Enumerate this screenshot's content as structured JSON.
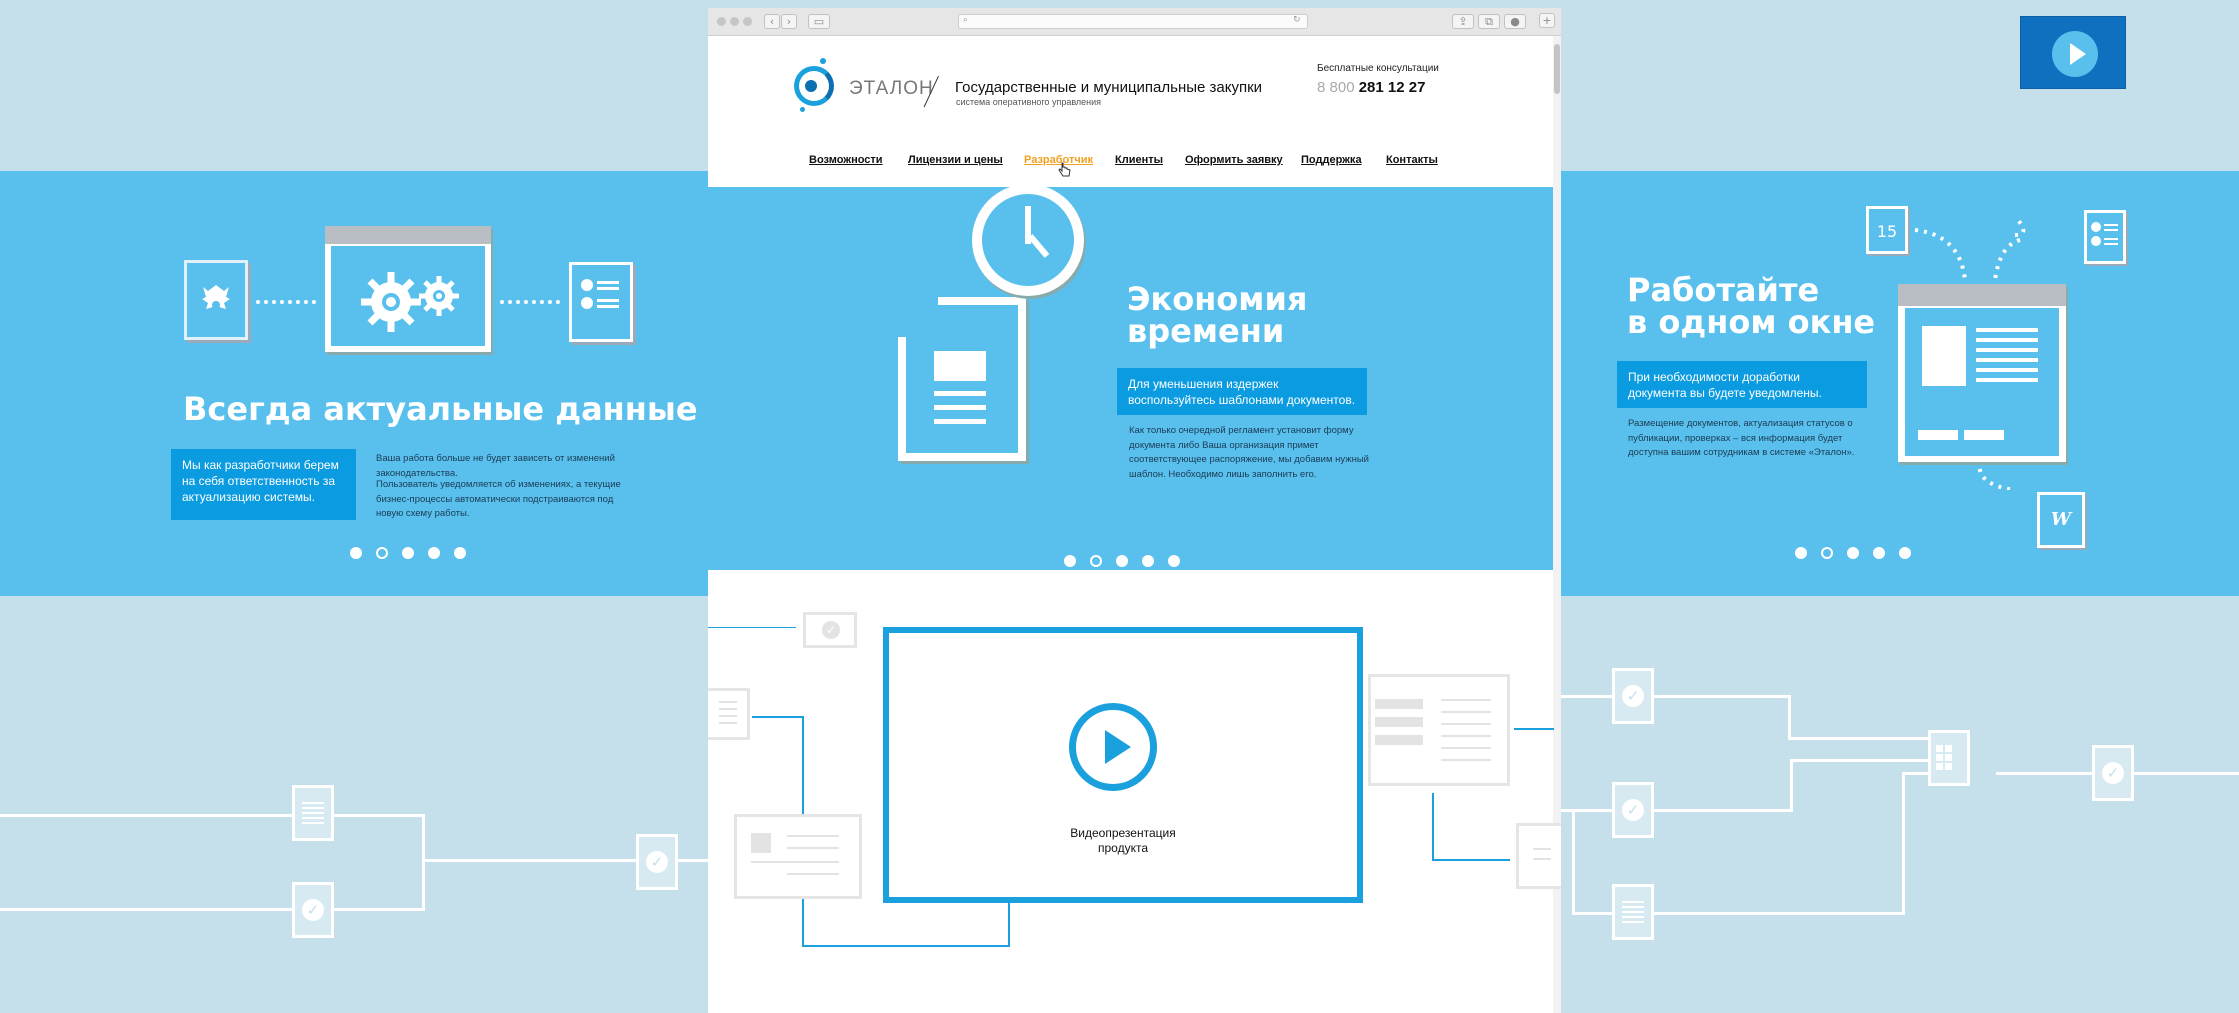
{
  "colors": {
    "accent": "#1aa1dd",
    "hero": "#59c0ee",
    "nav_active": "#f0a020",
    "box": "#0a9be0",
    "backdrop": "#c5dfeb"
  },
  "header": {
    "brand": "ЭТАЛОН",
    "title": "Государственные и муниципальные закупки",
    "subtitle": "система оперативного управления",
    "consult_label": "Бесплатные консультации",
    "phone_prefix": "8 800",
    "phone_number": "281 12 27"
  },
  "nav": {
    "items": [
      {
        "label": "Возможности"
      },
      {
        "label": "Лицензии и цены"
      },
      {
        "label": "Разработчик",
        "active": true
      },
      {
        "label": "Клиенты"
      },
      {
        "label": "Оформить заявку"
      },
      {
        "label": "Поддержка"
      },
      {
        "label": "Контакты"
      }
    ]
  },
  "hero": {
    "title_line1": "Экономия",
    "title_line2": "времени",
    "box_text": "Для уменьшения издержек воспользуйтесь шаблонами документов.",
    "description": "Как только очередной регламент установит форму документа либо Ваша организация примет соответствующее распоряжение, мы добавим нужный шаблон. Необходимо лишь заполнить его.",
    "active_dot": 1
  },
  "left_slide": {
    "title": "Всегда актуальные данные",
    "box_text": "Мы как разработчики берем на себя ответственность за актуализацию системы.",
    "description_1": "Ваша работа больше не будет зависеть от изменений законодательства.",
    "description_2": "Пользователь уведомляется об изменениях, а текущие бизнес-процессы автоматически подстраиваются под новую схему работы.",
    "active_dot": 1
  },
  "right_slide": {
    "title_line1": "Работайте",
    "title_line2": "в одном окне",
    "box_text": "При необходимости доработки документа вы будете уведомлены.",
    "description": "Размещение документов, актуализация статусов о публикации, проверках – вся информация будет доступна вашим сотрудникам в системе «Эталон».",
    "calendar_day": "15",
    "word_letter": "W",
    "active_dot": 1
  },
  "video": {
    "caption_line1": "Видеопрезентация",
    "caption_line2": "продукта"
  },
  "icons": {
    "play": "play-icon",
    "search": "search-icon",
    "reload": "reload-icon",
    "check": "check-icon",
    "gear": "gear-icon",
    "clock": "clock-icon",
    "emblem": "coat-of-arms-icon",
    "calendar": "calendar-icon",
    "word": "word-doc-icon",
    "grid": "grid-icon",
    "cursor": "hand-cursor-icon"
  }
}
